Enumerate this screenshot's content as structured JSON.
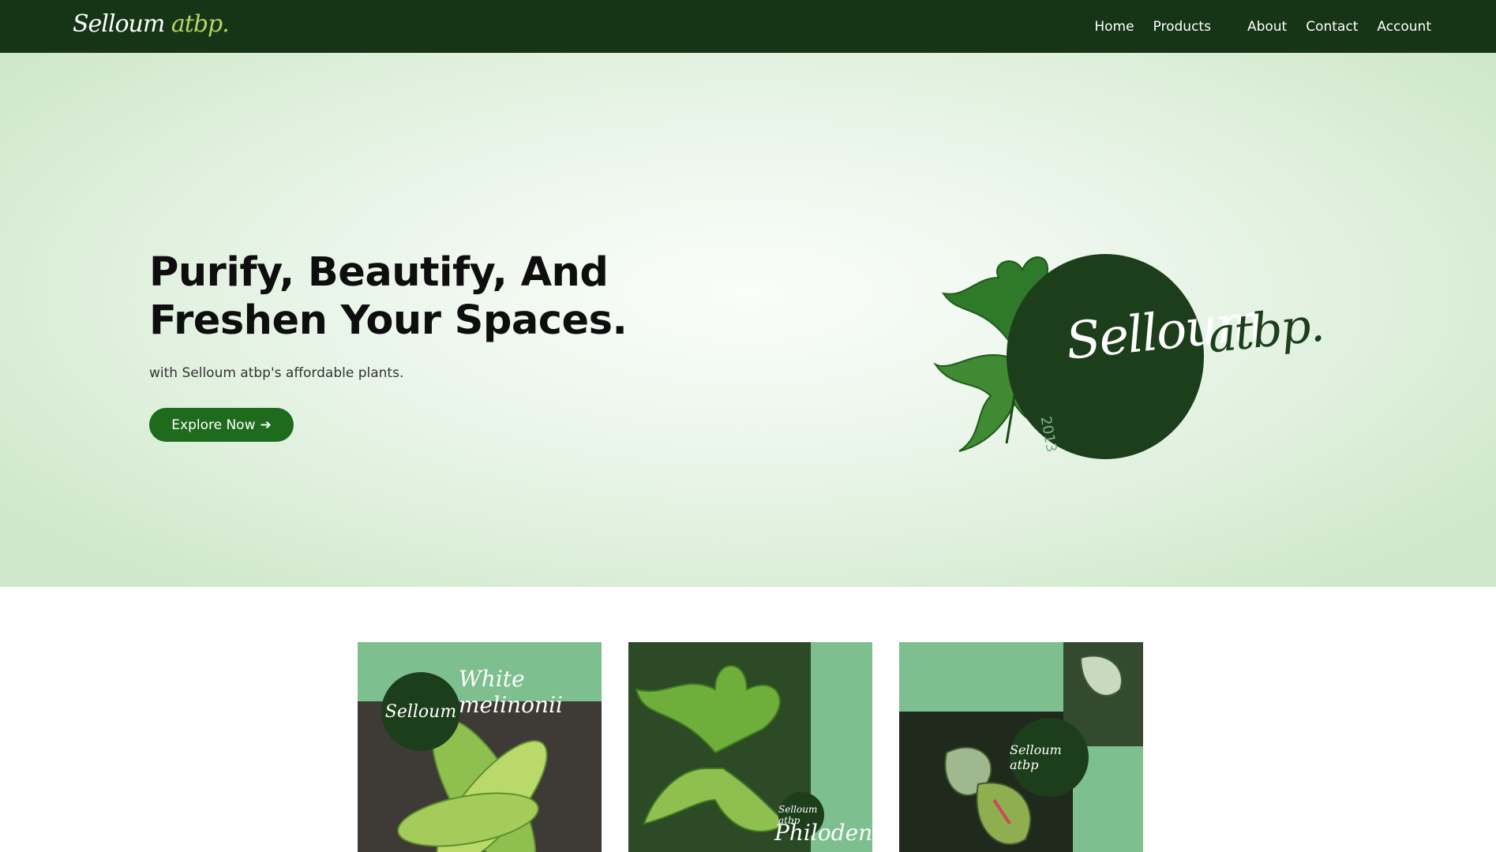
{
  "nav": {
    "logo_text": "Selloum",
    "logo_accent": "atbp.",
    "links": [
      {
        "label": "Home"
      },
      {
        "label": "Products"
      },
      {
        "label": "About"
      },
      {
        "label": "Contact"
      },
      {
        "label": "Account"
      }
    ]
  },
  "hero": {
    "title_line1": "Purify, Beautify, And",
    "title_line2": "Freshen Your Spaces.",
    "subtitle": "with Selloum atbp's affordable plants.",
    "cta_label": "Explore Now",
    "cta_icon": "➔"
  },
  "emblem": {
    "script_main": "Selloum",
    "script_suffix": "atbp.",
    "year": "2013"
  },
  "products": [
    {
      "caption": "White melinonii",
      "logo": "Selloum"
    },
    {
      "caption": "Philodendron",
      "logo": "Selloum atbp"
    },
    {
      "caption": "",
      "logo": "Selloum atbp"
    }
  ],
  "colors": {
    "nav_bg": "#163516",
    "brand_dark": "#1d3e1b",
    "cta_bg": "#1e6b1e",
    "card_green": "#7dbf8f",
    "hero_bg": "#dcefd9"
  }
}
